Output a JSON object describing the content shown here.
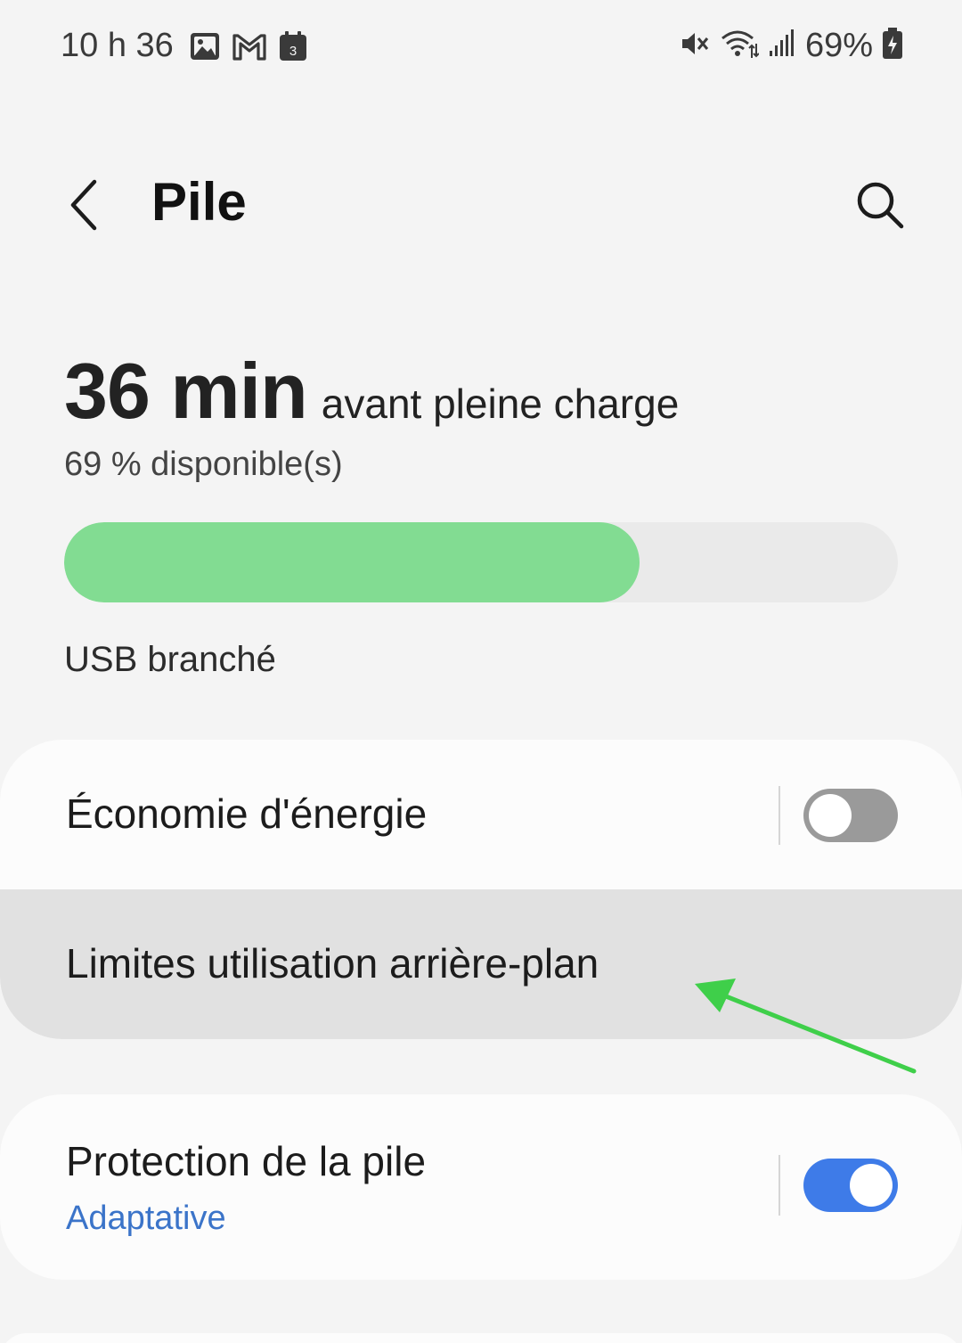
{
  "status_bar": {
    "time": "10 h 36",
    "notification_icons": [
      "gallery-icon",
      "gmail-icon",
      "calendar-icon"
    ],
    "calendar_day": "3",
    "system_icons": [
      "mute-icon",
      "wifi-icon",
      "signal-icon"
    ],
    "battery_percent": "69%"
  },
  "header": {
    "title": "Pile"
  },
  "battery": {
    "time_value": "36 min",
    "time_suffix": "avant pleine charge",
    "available_text": "69 % disponible(s)",
    "level_fraction": 0.69,
    "charge_status": "USB branché",
    "fill_color": "#82dc92"
  },
  "settings": {
    "power_saving": {
      "label": "Économie d'énergie",
      "enabled": false
    },
    "background_limits": {
      "label": "Limites utilisation arrière-plan"
    },
    "battery_protection": {
      "label": "Protection de la pile",
      "value": "Adaptative",
      "enabled": true
    }
  },
  "colors": {
    "accent": "#3e7be8",
    "subtext_blue": "#3b74c9",
    "annotation_arrow": "#3fcf4a"
  }
}
